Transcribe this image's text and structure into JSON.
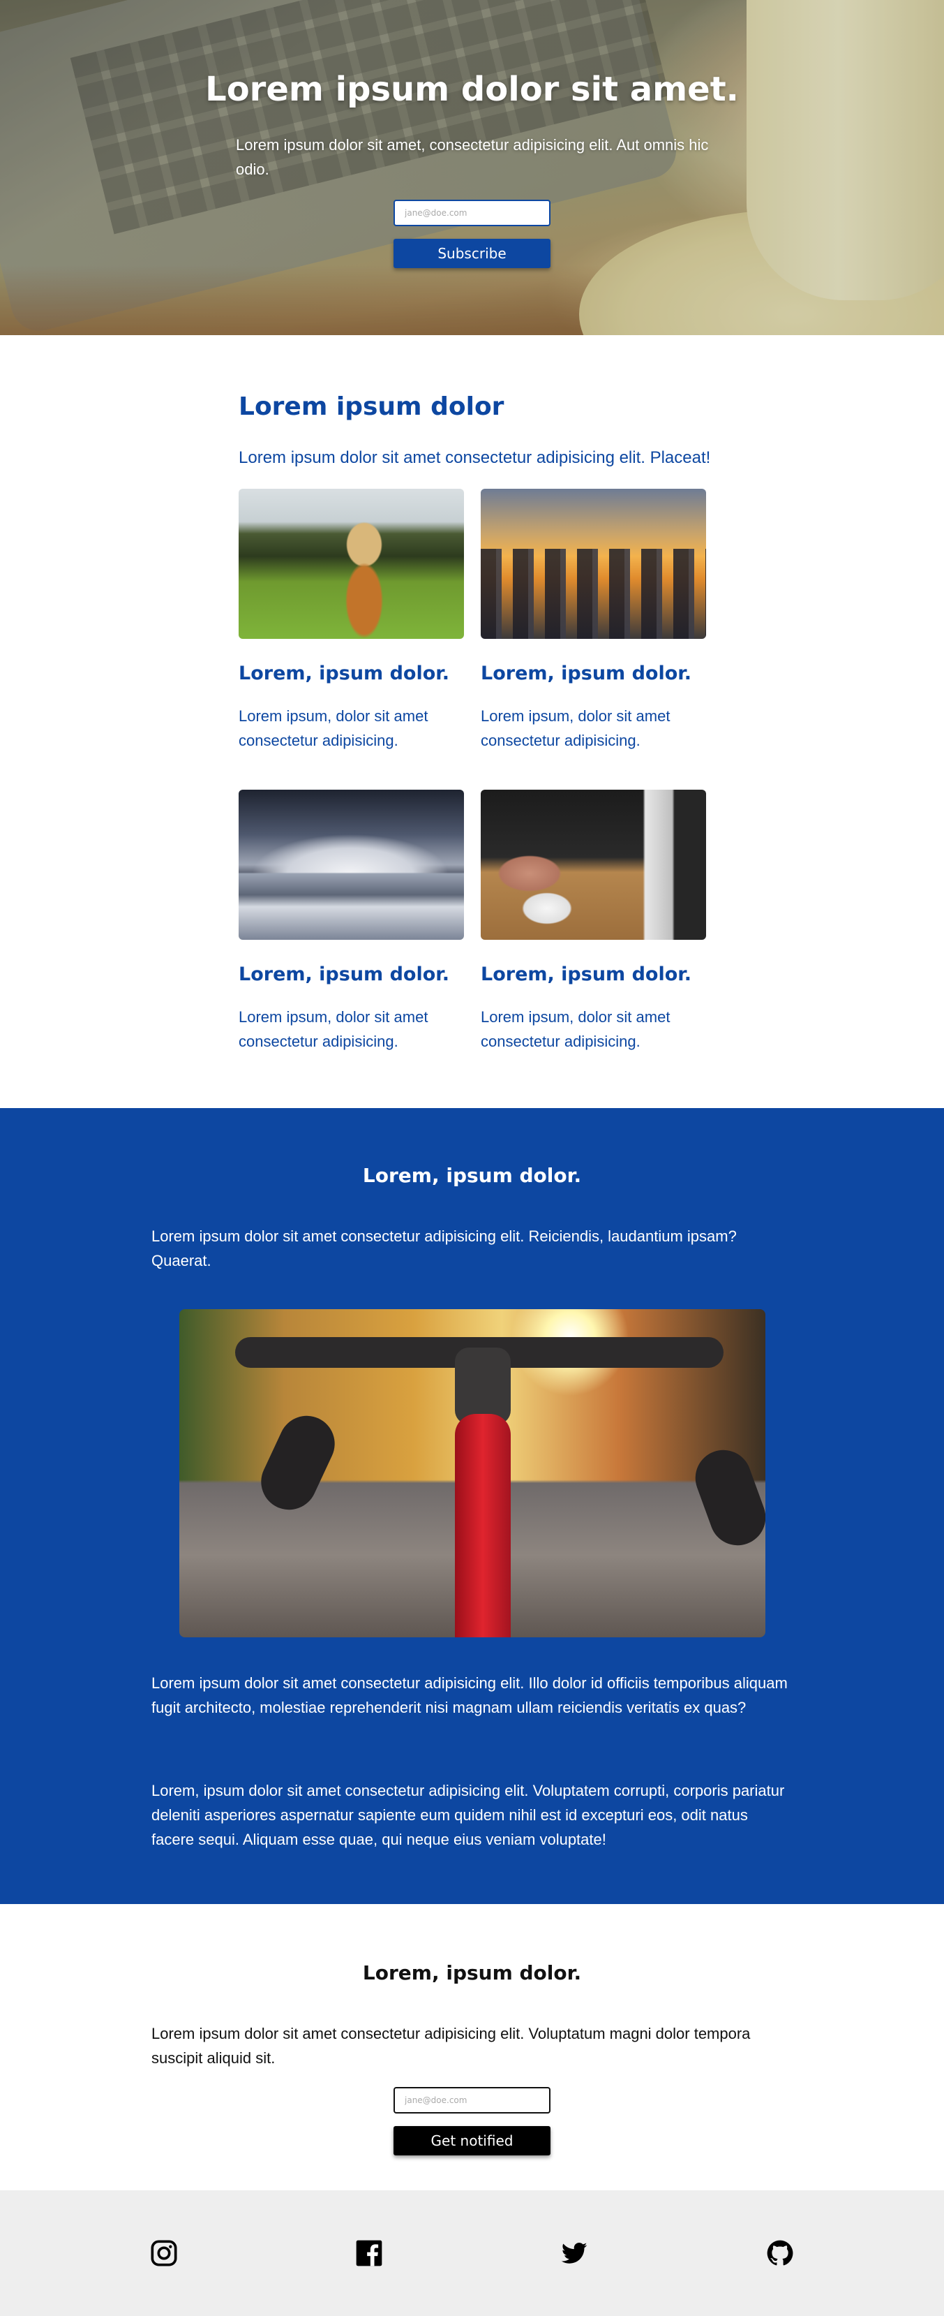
{
  "hero": {
    "title": "Lorem ipsum dolor sit amet.",
    "subtitle": "Lorem ipsum dolor sit amet, consectetur adipisicing elit. Aut omnis hic odio.",
    "email_placeholder": "jane@doe.com",
    "subscribe_label": "Subscribe"
  },
  "features": {
    "heading": "Lorem ipsum dolor",
    "lead": "Lorem ipsum dolor sit amet consectetur adipisicing elit. Placeat!",
    "cards": [
      {
        "title": "Lorem, ipsum dolor.",
        "text": "Lorem ipsum, dolor sit amet consectetur adipisicing."
      },
      {
        "title": "Lorem, ipsum dolor.",
        "text": "Lorem ipsum, dolor sit amet consectetur adipisicing."
      },
      {
        "title": "Lorem, ipsum dolor.",
        "text": "Lorem ipsum, dolor sit amet consectetur adipisicing."
      },
      {
        "title": "Lorem, ipsum dolor.",
        "text": "Lorem ipsum, dolor sit amet consectetur adipisicing."
      }
    ]
  },
  "about": {
    "heading": "Lorem, ipsum dolor.",
    "p1": "Lorem ipsum dolor sit amet consectetur adipisicing elit. Reiciendis, laudantium ipsam? Quaerat.",
    "p2": "Lorem ipsum dolor sit amet consectetur adipisicing elit. Illo dolor id officiis temporibus aliquam fugit architecto, molestiae reprehenderit nisi magnam ullam reiciendis veritatis ex quas?",
    "p3": "Lorem, ipsum dolor sit amet consectetur adipisicing elit. Voluptatem corrupti, corporis pariatur deleniti asperiores aspernatur sapiente eum quidem nihil est id excepturi eos, odit natus facere sequi. Aliquam esse quae, qui neque eius veniam voluptate!"
  },
  "notify": {
    "heading": "Lorem, ipsum dolor.",
    "text": "Lorem ipsum dolor sit amet consectetur adipisicing elit. Voluptatum magni dolor tempora suscipit aliquid sit.",
    "email_placeholder": "jane@doe.com",
    "button_label": "Get notified"
  },
  "footer": {
    "icons": [
      "instagram-icon",
      "facebook-icon",
      "twitter-icon",
      "github-icon"
    ]
  },
  "colors": {
    "primary": "#0d47a1",
    "footer_bg": "#eeeeee",
    "dark_button": "#000000"
  }
}
